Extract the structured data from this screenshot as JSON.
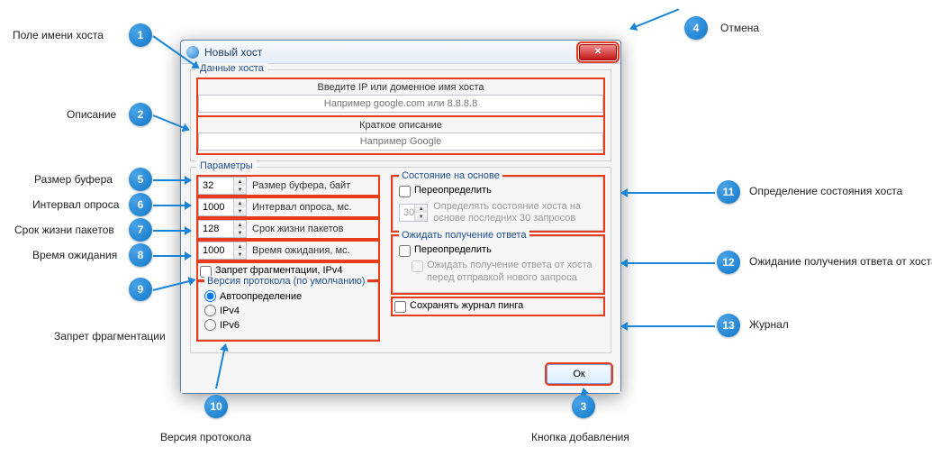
{
  "window": {
    "title": "Новый хост"
  },
  "hostdata": {
    "legend": "Данные хоста",
    "ip_label": "Введите IP или доменное имя хоста",
    "ip_placeholder": "Например google.com или 8.8.8.8",
    "desc_label": "Краткое описание",
    "desc_placeholder": "Например Google"
  },
  "params": {
    "legend": "Параметры",
    "buffer": {
      "value": "32",
      "label": "Размер буфера, байт"
    },
    "interval": {
      "value": "1000",
      "label": "Интервал опроса, мс."
    },
    "ttl": {
      "value": "128",
      "label": "Срок жизни пакетов"
    },
    "timeout": {
      "value": "1000",
      "label": "Время ожидания, мс."
    },
    "nofrag": "Запрет фрагментации, IPv4",
    "protocol": {
      "legend": "Версия протокола (по умолчанию)",
      "auto": "Автоопределение",
      "v4": "IPv4",
      "v6": "IPv6"
    },
    "statebox": {
      "legend": "Состояние на основе",
      "override": "Переопределить",
      "count": "30",
      "hint": "Определять состояние хоста на основе последних 30 запросов"
    },
    "waitbox": {
      "legend": "Ожидать получение ответа",
      "override": "Переопределить",
      "hint": "Ожидать получение ответа от хоста перед отправкой нового запроса"
    },
    "savelog": "Сохранять журнал пинга"
  },
  "ok": "Ок",
  "callouts": {
    "c1": "Поле имени хоста",
    "c2": "Описание",
    "c3": "Кнопка добавления",
    "c4": "Отмена",
    "c5": "Размер буфера",
    "c6": "Интервал опроса",
    "c7": "Срок жизни пакетов",
    "c8": "Время ожидания",
    "c9": "Запрет фрагментации",
    "c10": "Версия протокола",
    "c11": "Определение состояния хоста",
    "c12": "Ожидание получения ответа от хоста",
    "c13": "Журнал"
  }
}
